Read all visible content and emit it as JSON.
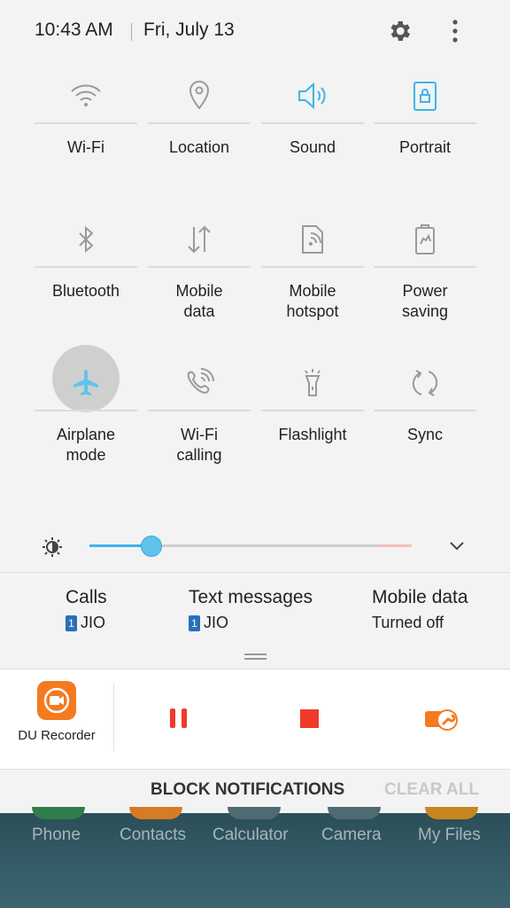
{
  "status": {
    "time": "10:43 AM",
    "date": "Fri, July 13"
  },
  "icons": {
    "settings": "gear-icon",
    "more": "more-vert-icon"
  },
  "colors": {
    "accent": "#3db4e8",
    "record": "#f03a2a",
    "du_orange": "#f47a1f",
    "sim_blue": "#2a6fb8"
  },
  "tiles": [
    {
      "label": "Wi-Fi",
      "icon": "wifi-icon",
      "active": false
    },
    {
      "label": "Location",
      "icon": "location-icon",
      "active": false
    },
    {
      "label": "Sound",
      "icon": "sound-icon",
      "active": true
    },
    {
      "label": "Portrait",
      "icon": "portrait-lock-icon",
      "active": true
    },
    {
      "label": "Bluetooth",
      "icon": "bluetooth-icon",
      "active": false
    },
    {
      "label": "Mobile\ndata",
      "icon": "mobile-data-icon",
      "active": false
    },
    {
      "label": "Mobile\nhotspot",
      "icon": "hotspot-icon",
      "active": false
    },
    {
      "label": "Power\nsaving",
      "icon": "power-saving-icon",
      "active": false
    },
    {
      "label": "Airplane\nmode",
      "icon": "airplane-icon",
      "active": false
    },
    {
      "label": "Wi-Fi\ncalling",
      "icon": "wifi-calling-icon",
      "active": false
    },
    {
      "label": "Flashlight",
      "icon": "flashlight-icon",
      "active": false
    },
    {
      "label": "Sync",
      "icon": "sync-icon",
      "active": false
    }
  ],
  "brightness": {
    "level": 0.19
  },
  "sim": {
    "calls": {
      "title": "Calls",
      "badge": "1",
      "value": "JIO"
    },
    "texts": {
      "title": "Text messages",
      "badge": "1",
      "value": "JIO"
    },
    "data": {
      "title": "Mobile data",
      "value": "Turned off"
    }
  },
  "recorder": {
    "app_name": "DU Recorder"
  },
  "actions": {
    "block": "BLOCK NOTIFICATIONS",
    "clear": "CLEAR ALL"
  },
  "dock": [
    "Phone",
    "Contacts",
    "Calculator",
    "Camera",
    "My Files"
  ]
}
